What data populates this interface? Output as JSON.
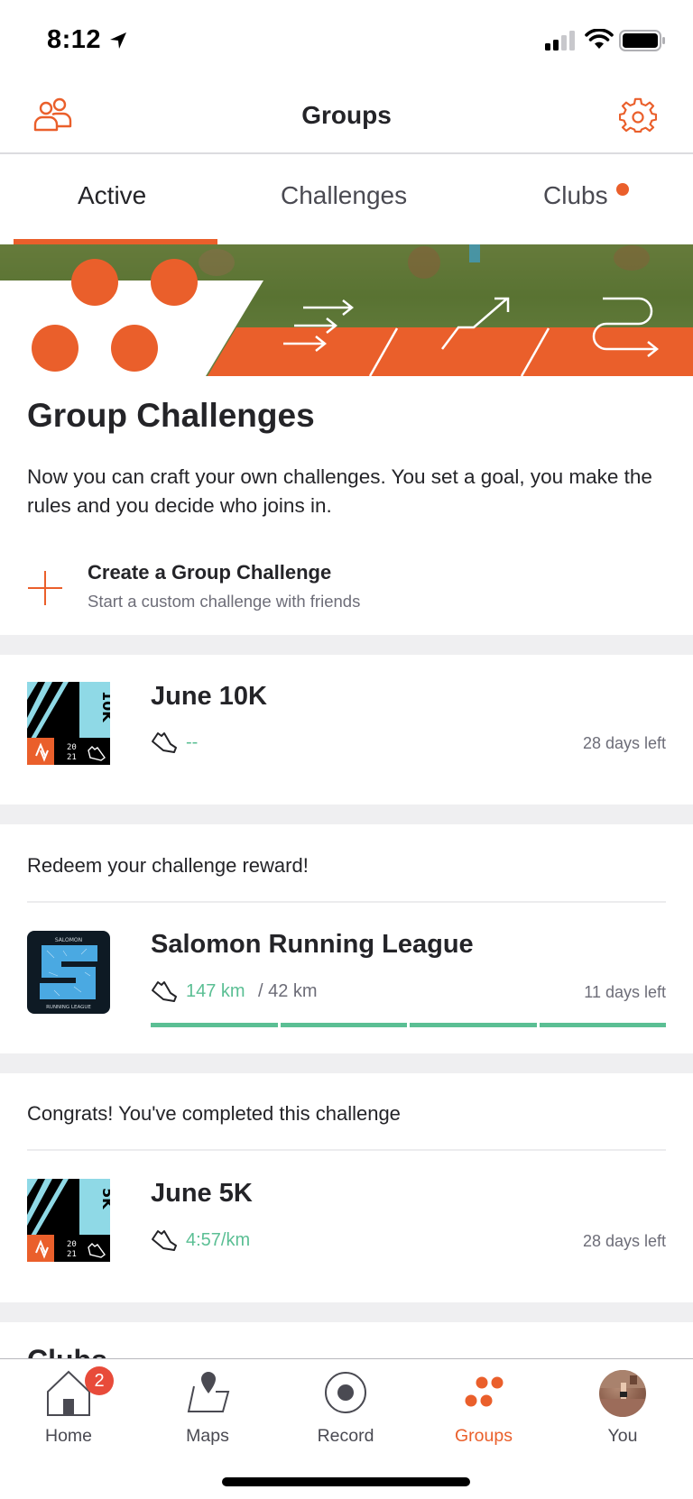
{
  "status_bar": {
    "time": "8:12",
    "location_icon": "location-arrow-icon",
    "signal_icon": "cellular-signal-icon",
    "wifi_icon": "wifi-icon",
    "battery_icon": "battery-icon"
  },
  "header": {
    "title": "Groups",
    "left_icon": "people-icon",
    "right_icon": "gear-icon"
  },
  "tabs": [
    {
      "label": "Active",
      "active": true
    },
    {
      "label": "Challenges",
      "active": false
    },
    {
      "label": "Clubs",
      "active": false,
      "has_notification_dot": true
    }
  ],
  "intro": {
    "title": "Group Challenges",
    "description": "Now you can craft your own challenges. You set a goal, you make the rules and you decide who joins in.",
    "create": {
      "icon": "plus-icon",
      "title": "Create a Group Challenge",
      "subtitle": "Start a custom challenge with friends"
    }
  },
  "challenges": [
    {
      "note": "",
      "badge": {
        "label": "10K",
        "year": "20 21"
      },
      "title": "June 10K",
      "value": "--",
      "goal": "",
      "days_left": "28 days left",
      "progress": null
    },
    {
      "note": "Redeem your challenge reward!",
      "badge": {
        "top": "SALOMON",
        "bottom": "RUNNING LEAGUE"
      },
      "title": "Salomon Running League",
      "value": "147 km",
      "goal": "/ 42 km",
      "days_left": "11 days left",
      "progress": {
        "segments": 4,
        "fraction": 1.0
      }
    },
    {
      "note": "Congrats! You've completed this challenge",
      "badge": {
        "label": "5K",
        "year": "20 21"
      },
      "title": "June 5K",
      "value": "4:57/km",
      "goal": "",
      "days_left": "28 days left",
      "progress": null
    }
  ],
  "clubs_section": {
    "title": "Clubs"
  },
  "bottom_nav": [
    {
      "label": "Home",
      "icon": "home-icon",
      "badge": "2",
      "active": false
    },
    {
      "label": "Maps",
      "icon": "map-icon",
      "active": false
    },
    {
      "label": "Record",
      "icon": "record-icon",
      "active": false
    },
    {
      "label": "Groups",
      "icon": "groups-icon",
      "active": true
    },
    {
      "label": "You",
      "icon": "avatar",
      "active": false
    }
  ],
  "colors": {
    "accent": "#ea5f2b",
    "progress_green": "#5bbf94",
    "badge_red": "#e84b3a",
    "badge_cyan": "#8fd9e6"
  }
}
